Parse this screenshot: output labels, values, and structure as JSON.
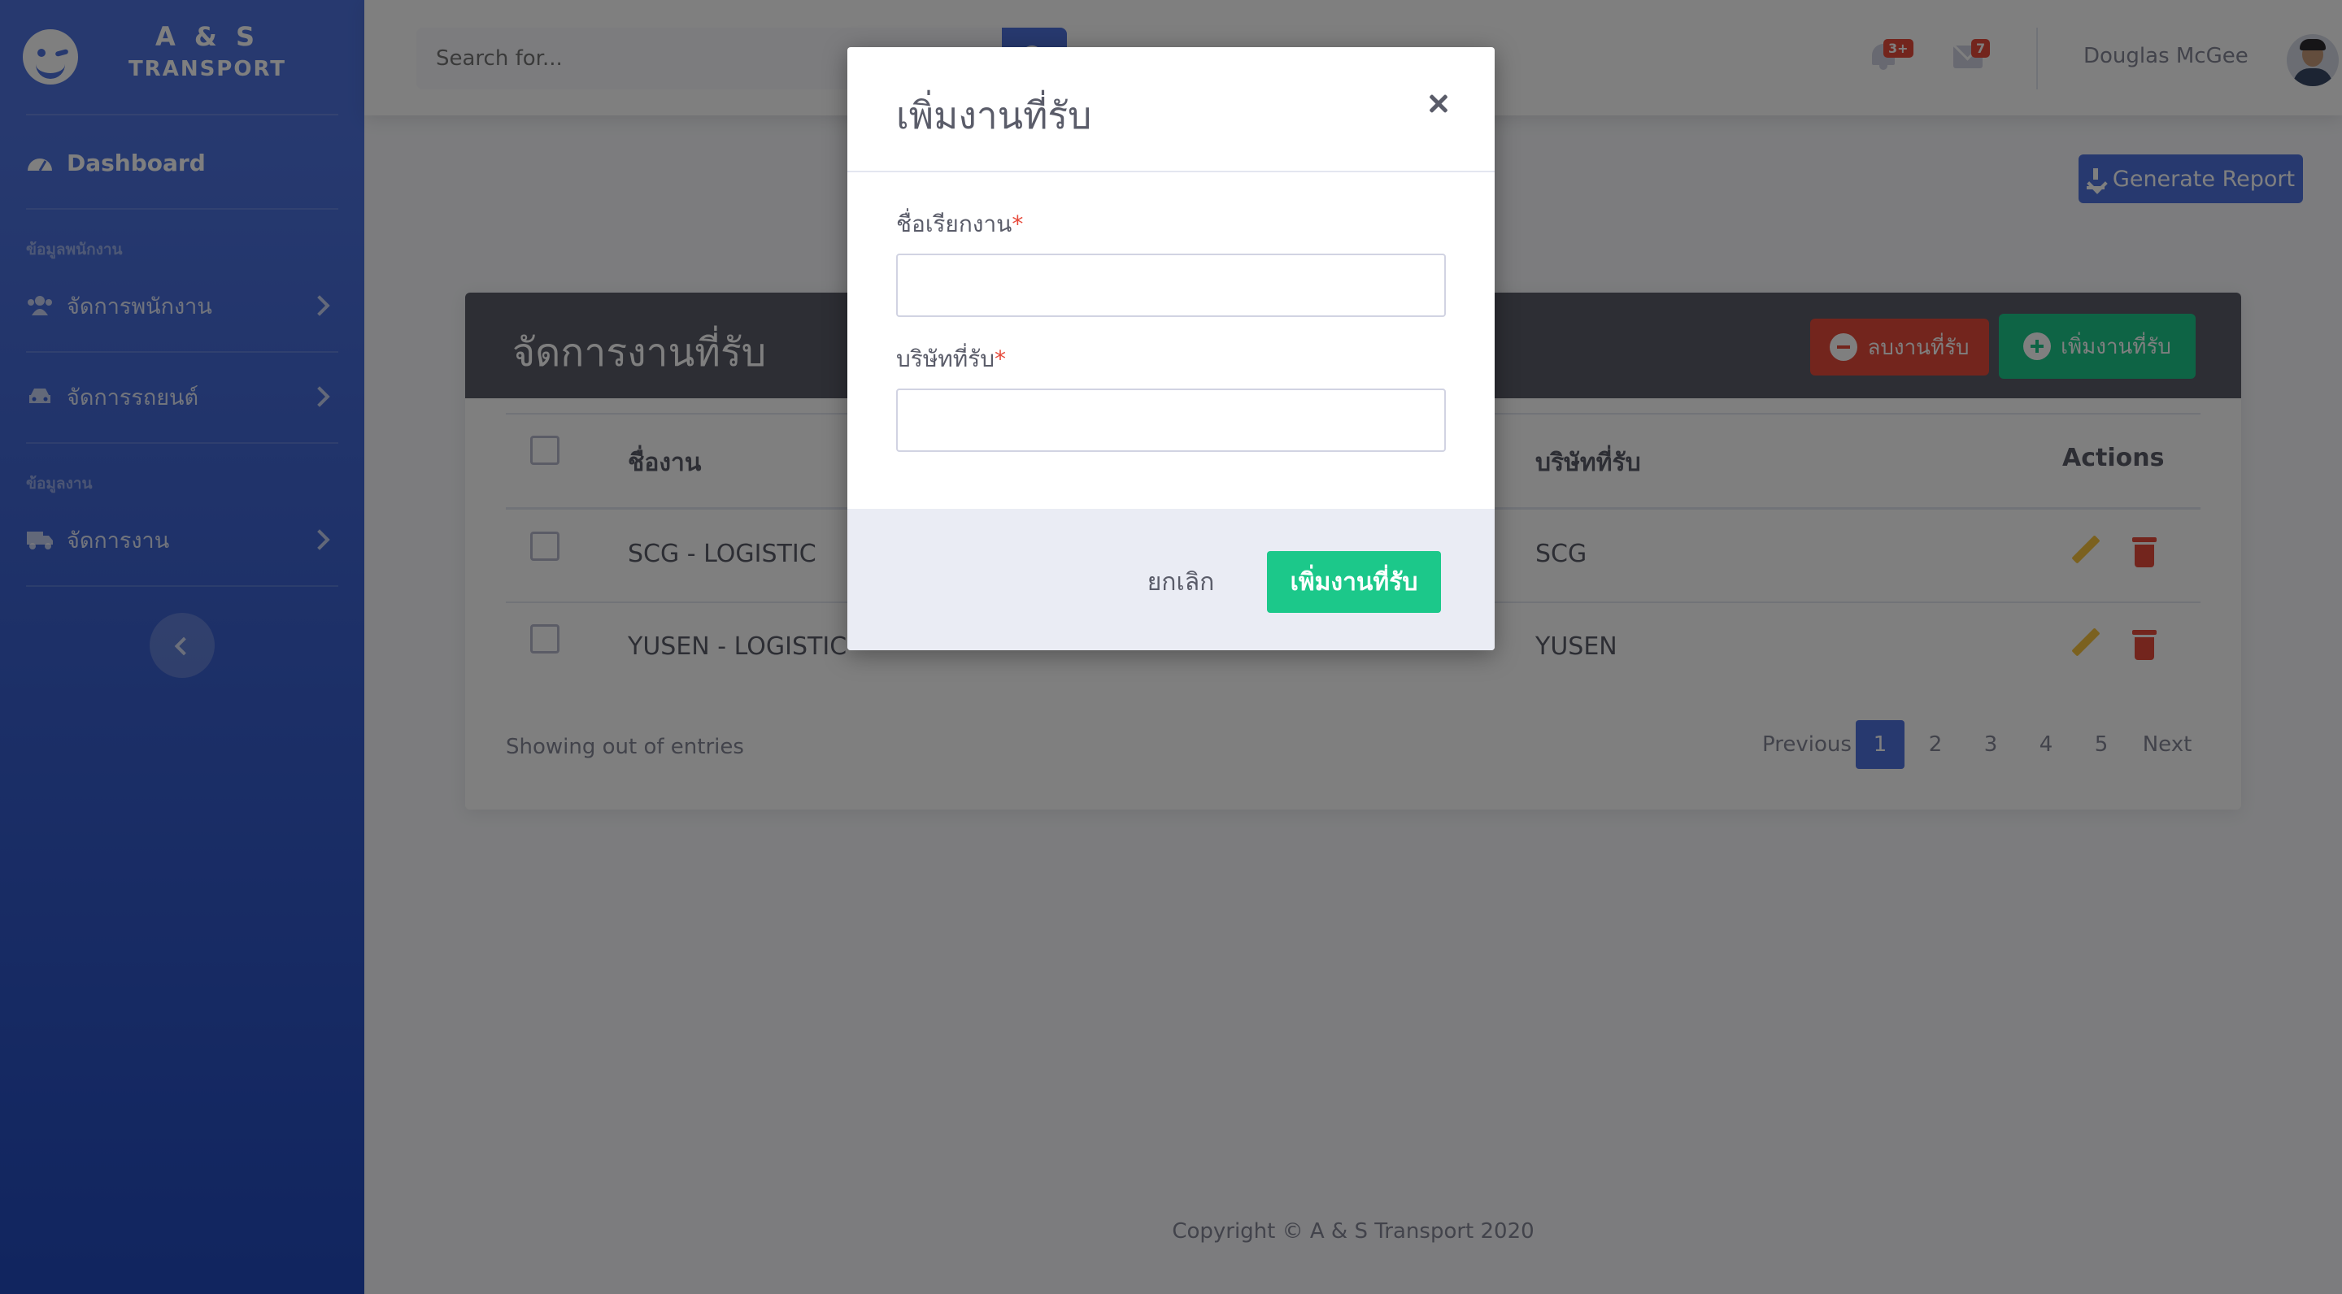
{
  "brand": {
    "line1": "A & S",
    "line2": "TRANSPORT",
    "icon": "laugh-wink-icon"
  },
  "sidebar": {
    "dashboard": "Dashboard",
    "heading_employee": "ข้อมูลพนักงาน",
    "manage_employee": "จัดการพนักงาน",
    "manage_vehicle": "จัดการรถยนต์",
    "heading_job": "ข้อมูลงาน",
    "manage_job": "จัดการงาน"
  },
  "topbar": {
    "search_placeholder": "Search for...",
    "alerts_badge": "3+",
    "messages_badge": "7",
    "user_name": "Douglas McGee"
  },
  "page": {
    "generate_report": "Generate Report"
  },
  "card": {
    "title": "จัดการงานที่รับ",
    "delete_button": "ลบงานที่รับ",
    "add_button": "เพิ่มงานที่รับ"
  },
  "table": {
    "headers": {
      "job_name": "ชื่องาน",
      "company": "บริษัทที่รับ",
      "actions": "Actions"
    },
    "rows": [
      {
        "job_name": "SCG - LOGISTIC",
        "company": "SCG"
      },
      {
        "job_name": "YUSEN - LOGISTIC",
        "company": "YUSEN"
      }
    ],
    "showing": "Showing out of entries"
  },
  "pagination": {
    "previous": "Previous",
    "pages": [
      "1",
      "2",
      "3",
      "4",
      "5"
    ],
    "active": "1",
    "next": "Next"
  },
  "footer": {
    "copyright": "Copyright © A & S Transport 2020"
  },
  "modal": {
    "title": "เพิ่มงานที่รับ",
    "field1_label": "ชื่อเรียกงาน",
    "field1_value": "",
    "field2_label": "บริษัทที่รับ",
    "field2_value": "",
    "required_mark": "*",
    "cancel": "ยกเลิก",
    "submit": "เพิ่มงานที่รับ"
  },
  "colors": {
    "primary": "#4e73df",
    "success": "#1cc88a",
    "danger": "#e74a3b",
    "warning": "#f6c23e",
    "card_header": "#5a5c69"
  }
}
